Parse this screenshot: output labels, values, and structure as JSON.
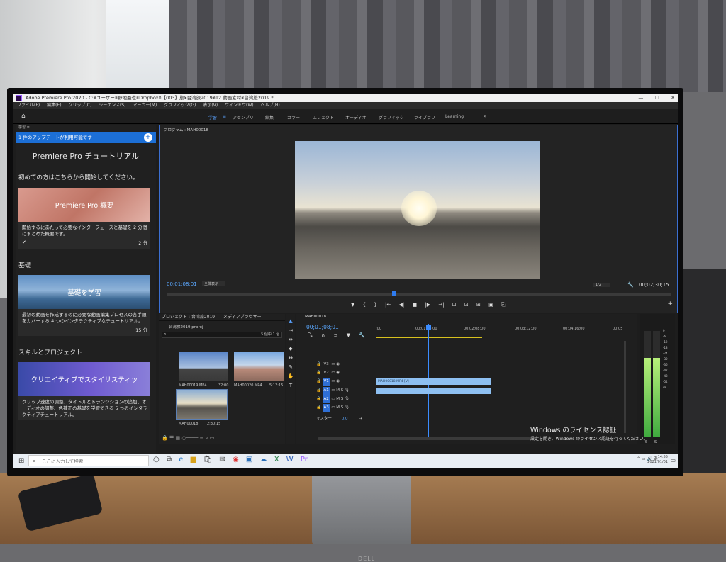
{
  "window": {
    "title": "Adobe Premiere Pro 2020 - C:¥ユーザー¥野地亜也¥Dropbox¥【003】旅¥台湾旅2019¥12 動画素材¥台湾旅2019 *",
    "controls": [
      "—",
      "☐",
      "✕"
    ]
  },
  "menu": [
    "ファイル(F)",
    "編集(E)",
    "クリップ(C)",
    "シーケンス(S)",
    "マーカー(M)",
    "グラフィック(G)",
    "表示(V)",
    "ウィンドウ(W)",
    "ヘルプ(H)"
  ],
  "workspaces": {
    "home_icon": "home-icon",
    "items": [
      "学習",
      "アセンブリ",
      "編集",
      "カラー",
      "エフェクト",
      "オーディオ",
      "グラフィック",
      "ライブラリ",
      "Learning",
      "»"
    ]
  },
  "learn": {
    "tab": "学習",
    "update": "1 件のアップデートが利用可能です",
    "update_plus": "+",
    "title": "Premiere Pro チュートリアル",
    "intro": "初めての方はこちらから開始してください。",
    "card1": {
      "image_text": "Premiere Pro 概要",
      "text": "開始するにあたって必要なインターフェースと基礎を 2 分間にまとめた概要です。",
      "duration": "2 分"
    },
    "section_basics": "基礎",
    "card2": {
      "image_text": "基礎を学習",
      "text": "最初の動画を作成するのに必要な動画編集プロセスの各手順をカバーする 4 つのインタラクティブなチュートリアル。",
      "duration": "15 分"
    },
    "section_skills": "スキルとプロジェクト",
    "card3": {
      "image_text": "クリエイティブでスタイリスティッ",
      "text": "クリップ速度の調整、タイトルとトランジションの追加、オーディオの調整、色補正の基礎を学習できる 5 つのインタラクティブチュートリアル。"
    }
  },
  "program": {
    "title": "プログラム : MAH00018",
    "timecode": "00;01;08;01",
    "fit": "全体表示",
    "resolution": "1/2",
    "duration": "00;02;30;15",
    "transport": [
      "▼",
      "{",
      "}",
      "|←",
      "◀|",
      "■",
      "|▶",
      "→|",
      "⊡",
      "⊡",
      "⊞",
      "▣",
      "⎘"
    ],
    "add": "+"
  },
  "project": {
    "tabs": [
      "プロジェクト : 台湾旅2019",
      "メディアブラウザー"
    ],
    "file": "台湾旅2019.prproj",
    "count": "5 個中 1 個...",
    "clips": [
      {
        "name": "MAH00019.MP4",
        "duration": "32:00"
      },
      {
        "name": "MAH00020.MP4",
        "duration": "5:13:15"
      },
      {
        "name": "MAH00018",
        "duration": "2:30:15"
      }
    ]
  },
  "timeline": {
    "tab": "MAH00018",
    "timecode": "00;01;08;01",
    "ruler": [
      ";00",
      "00;01;04;00",
      "00;02;08;00",
      "00;03;12;00",
      "00;04;16;00",
      "00;05"
    ],
    "tracks": [
      "V3",
      "V2",
      "V1",
      "A1",
      "A2",
      "A3"
    ],
    "video_clip": "MAH00018.MP4 [V]",
    "master_label": "マスター",
    "master_value": "0.0"
  },
  "meters": {
    "scale": [
      "0",
      "-6",
      "-12",
      "-18",
      "-24",
      "-30",
      "-36",
      "-42",
      "-48",
      "-54",
      "dB"
    ],
    "solo": [
      "S",
      "S"
    ]
  },
  "activation": {
    "title": "Windows のライセンス認証",
    "subtitle": "設定を開き、Windows のライセンス認証を行ってください。"
  },
  "taskbar": {
    "search": "ここに入力して検索",
    "time": "14:55",
    "date": "2021/01/01"
  },
  "monitor_brand": "DELL"
}
